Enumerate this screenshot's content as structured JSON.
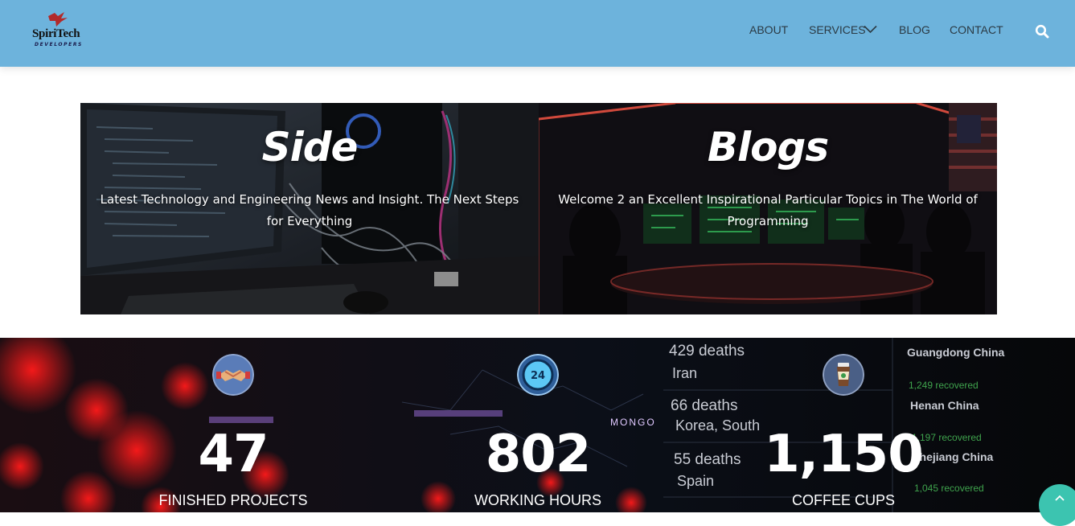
{
  "brand": {
    "name": "SpiriTech",
    "tagline": "DEVELOPERS"
  },
  "nav": {
    "items": [
      {
        "label": "ABOUT"
      },
      {
        "label": "SERVICES"
      },
      {
        "label": "BLOG"
      },
      {
        "label": "CONTACT"
      }
    ]
  },
  "cards": [
    {
      "title": "Side",
      "description": "Latest Technology and Engineering News and Insight. The Next Steps for Everything"
    },
    {
      "title": "Blogs",
      "description": "Welcome 2 an Excellent Inspirational Particular Topics in The World of Programming"
    }
  ],
  "stats": [
    {
      "icon": "handshake-icon",
      "value": "47",
      "label": "FINISHED PROJECTS"
    },
    {
      "icon": "clock-24-icon",
      "value": "802",
      "label": "WORKING HOURS",
      "icon_text": "24"
    },
    {
      "icon": "coffee-cup-icon",
      "value": "1,150",
      "label": "COFFEE CUPS"
    }
  ],
  "background_text": {
    "deaths_1": "429 deaths",
    "country_1": "Iran",
    "deaths_2": "66 deaths",
    "country_2": "Korea, South",
    "deaths_3": "55 deaths",
    "country_3": "Spain",
    "region_1": "Guangdong China",
    "recovered_1": "1,249 recovered",
    "region_2": "Henan China",
    "recovered_2": "1,197 recovered",
    "region_3": "Zhejiang China",
    "recovered_3": "1,045 recovered",
    "map_label_1": "MONGO"
  },
  "colors": {
    "header_bg": "#6db3dc",
    "scroll_top_bg": "#3cc4b0"
  }
}
